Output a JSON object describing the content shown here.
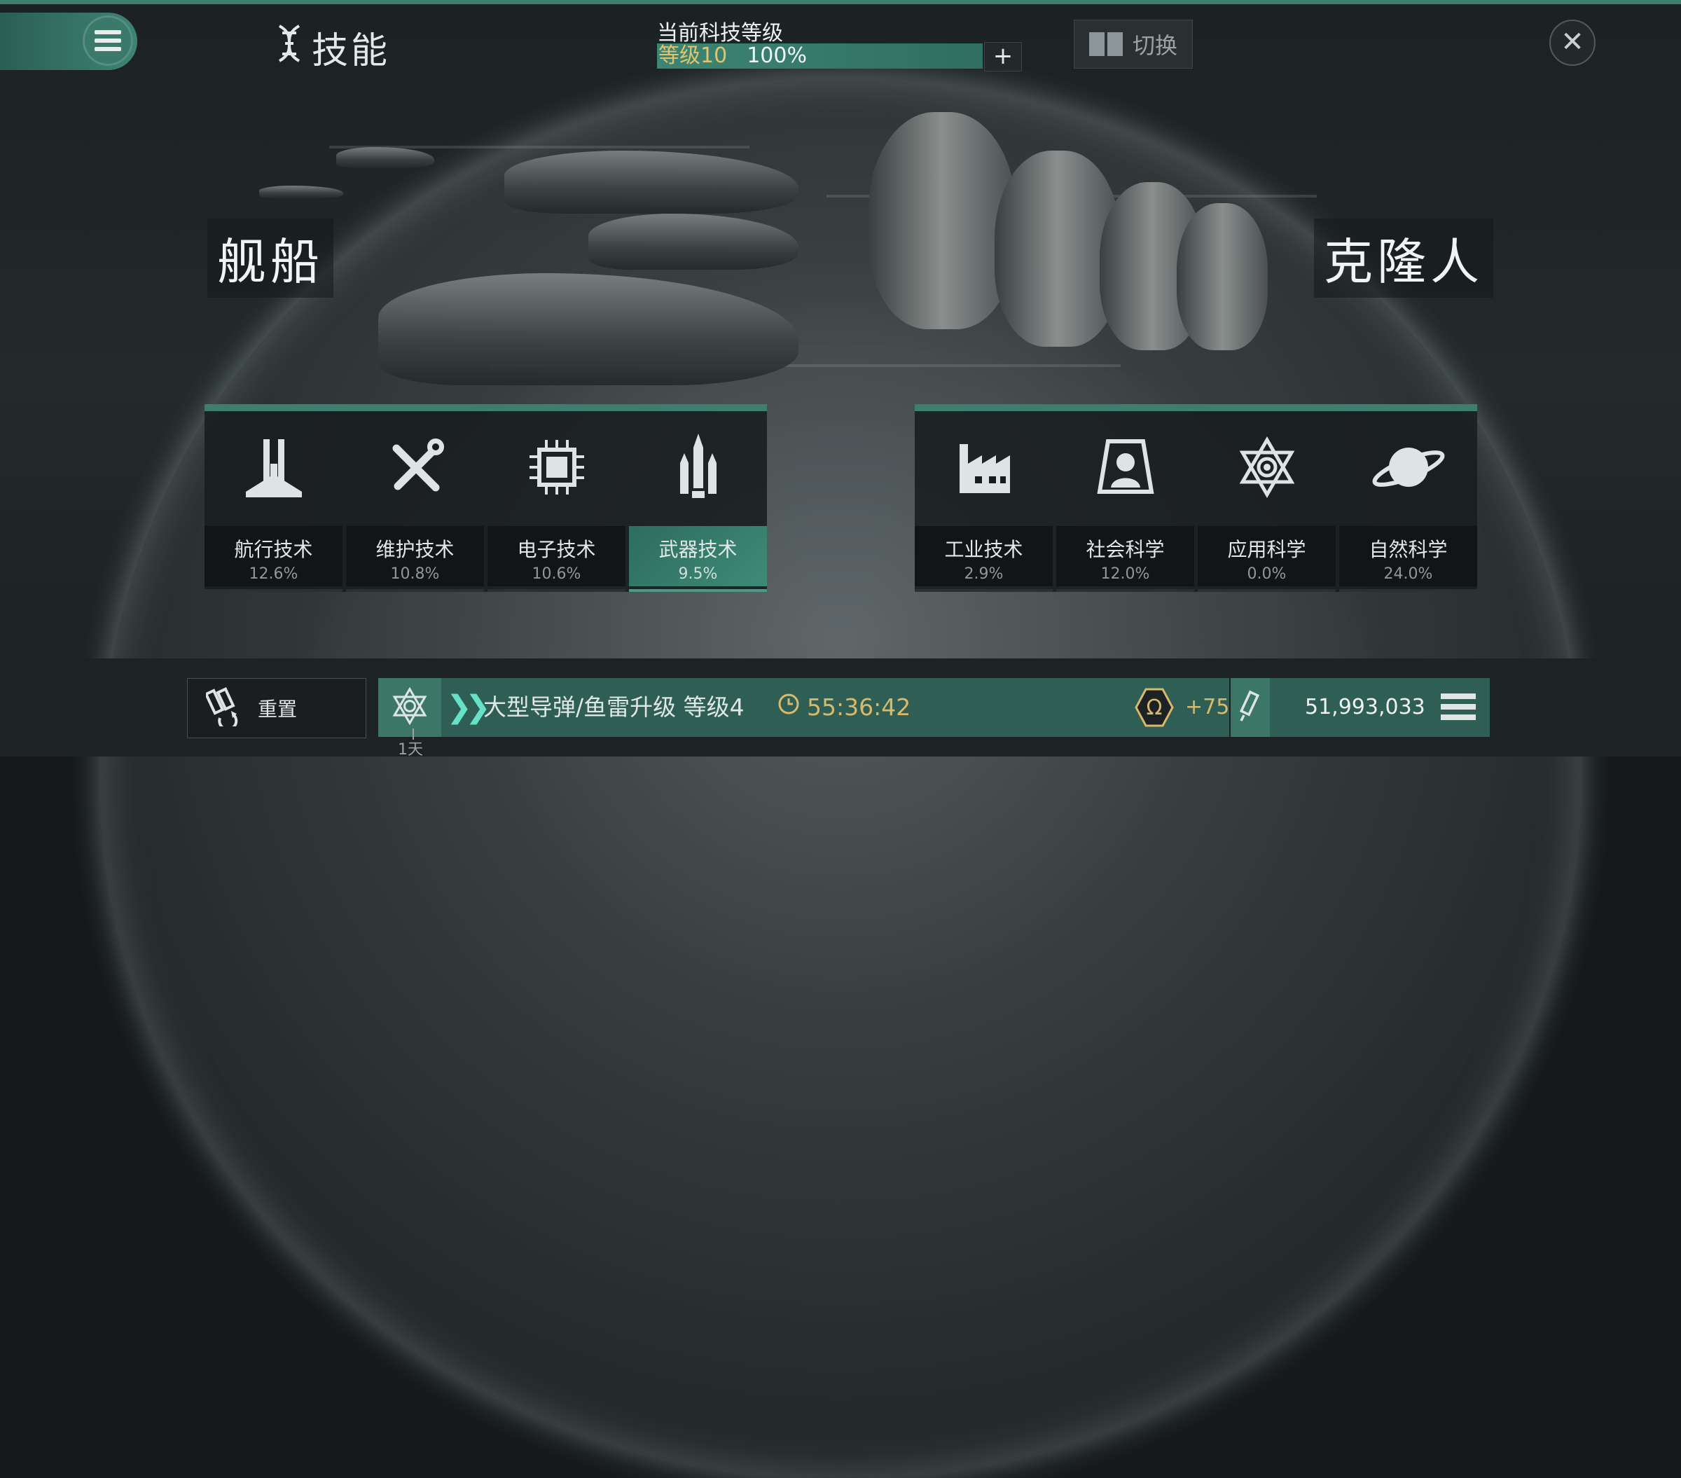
{
  "header": {
    "title": "技能",
    "title_icon": "dna-icon",
    "level_caption": "当前科技等级",
    "level_label": "等级10",
    "level_percent": "100%",
    "level_progress": 1.0,
    "plus_label": "+",
    "switch_label": "切换",
    "close_icon": "close-icon",
    "menu_icon": "menu-icon"
  },
  "sections": {
    "ships_label": "舰船",
    "clones_label": "克隆人"
  },
  "ship_skills": [
    {
      "name": "航行技术",
      "percent": "12.6%",
      "icon": "navigation-icon",
      "active": false
    },
    {
      "name": "维护技术",
      "percent": "10.8%",
      "icon": "wrench-screwdriver-icon",
      "active": false
    },
    {
      "name": "电子技术",
      "percent": "10.6%",
      "icon": "chip-icon",
      "active": false
    },
    {
      "name": "武器技术",
      "percent": "9.5%",
      "icon": "missiles-icon",
      "active": true
    }
  ],
  "clone_skills": [
    {
      "name": "工业技术",
      "percent": "2.9%",
      "icon": "factory-icon",
      "active": false
    },
    {
      "name": "社会科学",
      "percent": "12.0%",
      "icon": "person-frame-icon",
      "active": false
    },
    {
      "name": "应用科学",
      "percent": "0.0%",
      "icon": "atom-star-icon",
      "active": false
    },
    {
      "name": "自然科学",
      "percent": "24.0%",
      "icon": "planet-icon",
      "active": false
    }
  ],
  "bottom": {
    "reset_label": "重置",
    "queue_item": "大型导弹/鱼雷升级 等级",
    "queue_level": "4",
    "timer": "55:36:42",
    "bonus": "+75",
    "resource_value": "51,993,033",
    "day_label": "1天"
  },
  "colors": {
    "accent": "#3d7e6e",
    "gold": "#d9b96a",
    "highlight": "#66e0c6"
  }
}
